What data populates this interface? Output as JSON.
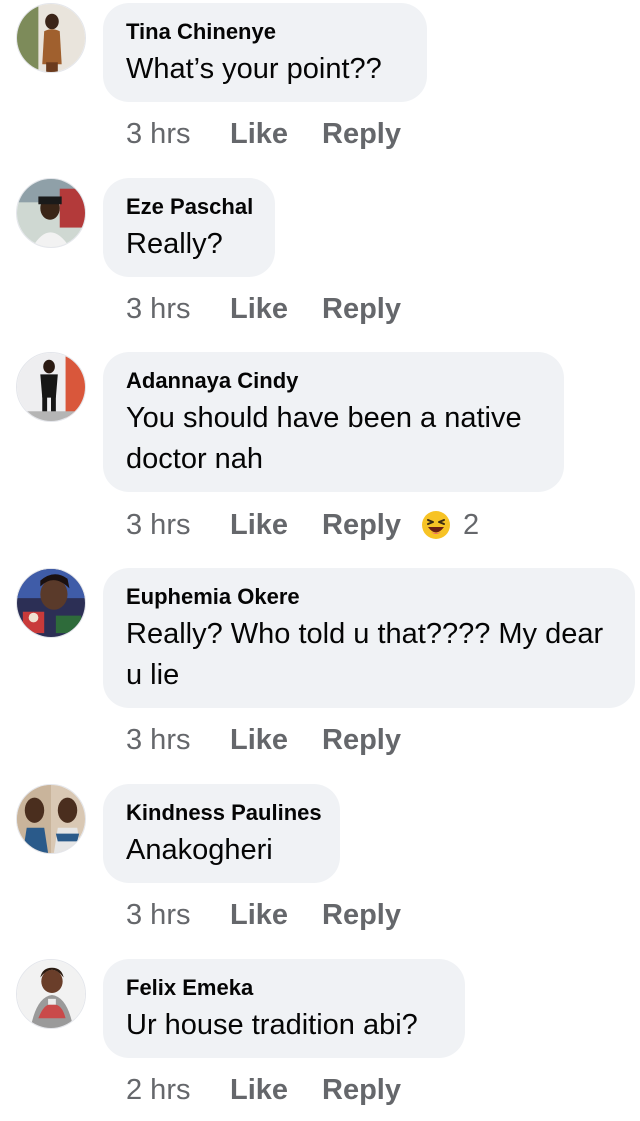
{
  "comments": [
    {
      "author": "Tina Chinenye",
      "text": "What’s your point??",
      "time": "3 hrs",
      "like": "Like",
      "reply": "Reply"
    },
    {
      "author": "Eze Paschal",
      "text": "Really?",
      "time": "3 hrs",
      "like": "Like",
      "reply": "Reply"
    },
    {
      "author": "Adannaya Cindy",
      "text": "You should have been a native doctor nah",
      "time": "3 hrs",
      "like": "Like",
      "reply": "Reply",
      "reaction_icon": "laughing-emoji-icon",
      "reaction_count": "2"
    },
    {
      "author": "Euphemia Okere",
      "text": "Really? Who told u that???? My dear u lie",
      "time": "3 hrs",
      "like": "Like",
      "reply": "Reply"
    },
    {
      "author": "Kindness Paulines",
      "text": "Anakogheri",
      "time": "3 hrs",
      "like": "Like",
      "reply": "Reply"
    },
    {
      "author": "Felix Emeka",
      "text": "Ur house tradition abi?",
      "time": "2 hrs",
      "like": "Like",
      "reply": "Reply"
    }
  ],
  "colors": {
    "bubble": "#f0f2f5",
    "meta": "#65676b",
    "text": "#050505"
  }
}
